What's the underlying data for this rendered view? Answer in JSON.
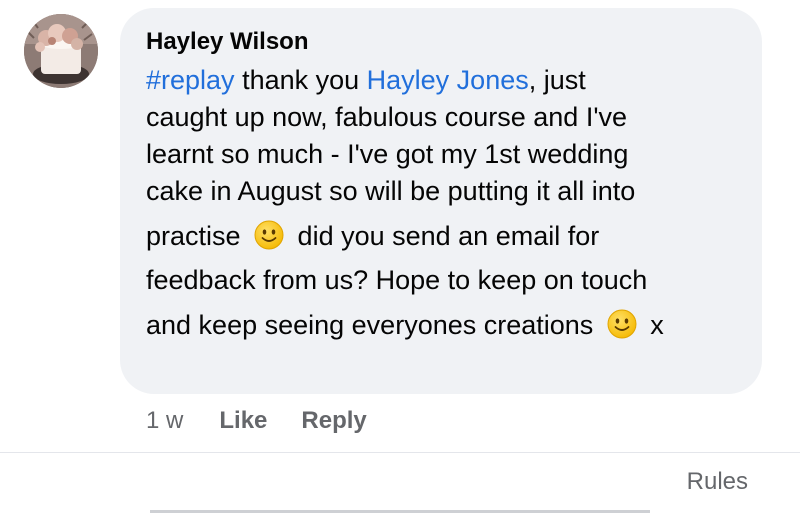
{
  "comment": {
    "author": "Hayley Wilson",
    "lines": [
      [
        {
          "t": "#replay",
          "link": true
        },
        {
          "t": " thank you "
        },
        {
          "t": "Hayley Jones",
          "link": true
        },
        {
          "t": ", just"
        }
      ],
      [
        {
          "t": "caught up now, fabulous course and I've"
        }
      ],
      [
        {
          "t": "learnt so much - I've got my 1st wedding"
        }
      ],
      [
        {
          "t": "cake in August so will be putting it all into"
        }
      ],
      [
        {
          "t": "practise "
        },
        {
          "emoji": "slightly-smiling-face"
        },
        {
          "t": " did you send an email for"
        }
      ],
      [
        {
          "t": "feedback from us? Hope to keep on touch"
        }
      ],
      [
        {
          "t": "and keep seeing everyones creations "
        },
        {
          "emoji": "slightly-smiling-face"
        },
        {
          "t": " x"
        }
      ]
    ],
    "timestamp": "1 w",
    "like_label": "Like",
    "reply_label": "Reply"
  },
  "footer": {
    "rules_label": "Rules"
  },
  "colors": {
    "link": "#216fdb",
    "bubble": "#f0f2f5",
    "muted": "#65676b"
  },
  "icons": {
    "emoji": "slightly-smiling-face-icon",
    "avatar": "wedding-cake-photo"
  }
}
